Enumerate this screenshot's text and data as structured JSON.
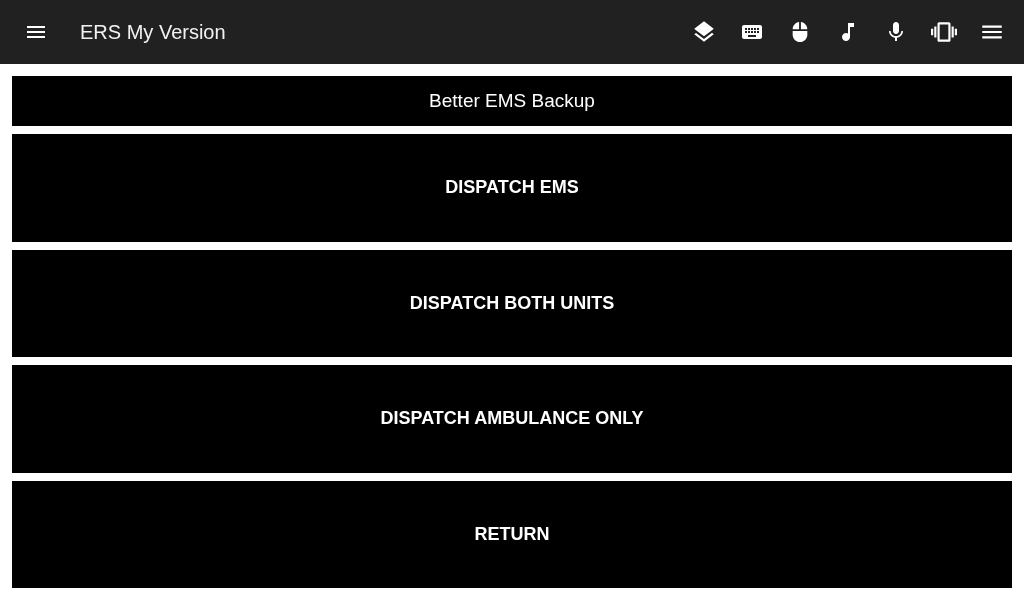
{
  "app_bar": {
    "title": "ERS My Version"
  },
  "header": {
    "title": "Better EMS Backup"
  },
  "buttons": [
    {
      "label": "DISPATCH EMS"
    },
    {
      "label": "DISPATCH BOTH UNITS"
    },
    {
      "label": "DISPATCH AMBULANCE ONLY"
    },
    {
      "label": "RETURN"
    }
  ]
}
